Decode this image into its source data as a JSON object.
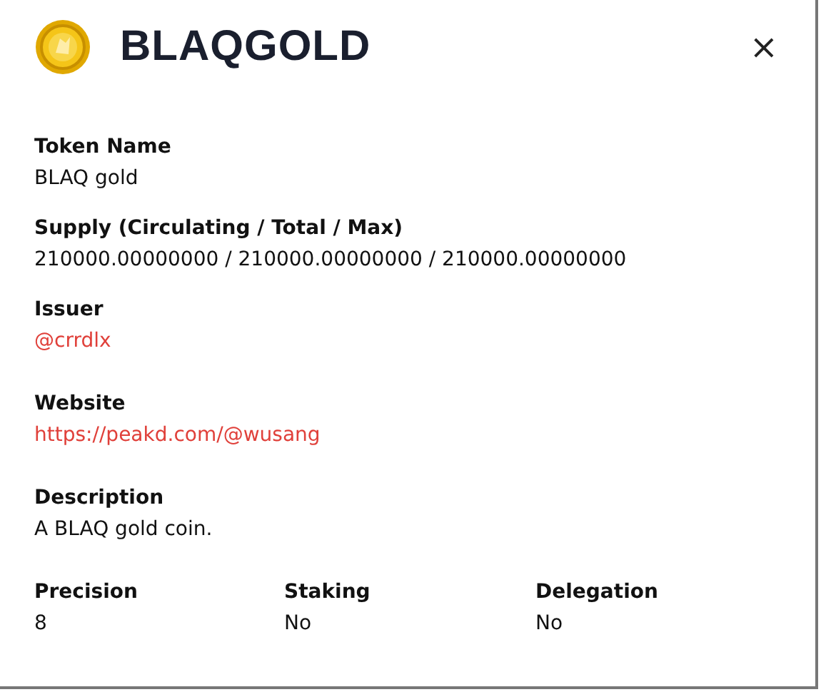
{
  "dialog": {
    "title": "BLAQGOLD",
    "close": "×"
  },
  "fields": [
    {
      "label": "Token Name",
      "value": "BLAQ gold",
      "kind": "text"
    },
    {
      "label": "Supply (Circulating / Total / Max)",
      "value": "210000.00000000 / 210000.00000000 / 210000.00000000",
      "kind": "text"
    },
    {
      "label": "Issuer",
      "value": "@crrdlx",
      "kind": "link"
    },
    {
      "label": "Website",
      "value": "https://peakd.com/@wusang",
      "kind": "link"
    },
    {
      "label": "Description",
      "value": "A BLAQ gold coin.",
      "kind": "text"
    }
  ],
  "properties": [
    {
      "label": "Precision",
      "value": "8"
    },
    {
      "label": "Staking",
      "value": "No"
    },
    {
      "label": "Delegation",
      "value": "No"
    }
  ]
}
